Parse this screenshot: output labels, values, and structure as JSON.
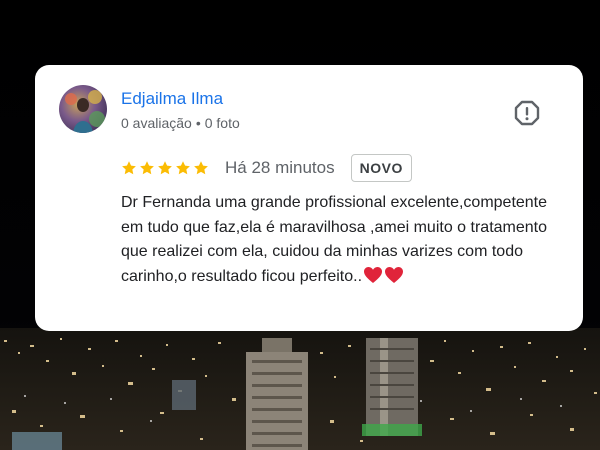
{
  "review": {
    "author_name": "Edjailma Ilma",
    "author_reviews": "0 avaliação",
    "meta_separator": "•",
    "author_photos": "0 foto",
    "rating": 5,
    "rating_max": 5,
    "time_ago": "Há 28 minutos",
    "badge": "NOVO",
    "text": "Dr Fernanda uma grande profissional excelente,competente em tudo que faz,ela é maravilhosa ,amei muito o tratamento que realizei com ela, cuidou da minhas varizes com todo carinho,o resultado ficou perfeito..",
    "emoji": "❤️❤️"
  },
  "icons": {
    "report": "report-flag-icon",
    "star": "star-icon",
    "heart": "heart-icon"
  },
  "colors": {
    "name": "#1a73e8",
    "star": "#fbbc04",
    "heart": "#e0243a",
    "muted": "#5f6368"
  }
}
